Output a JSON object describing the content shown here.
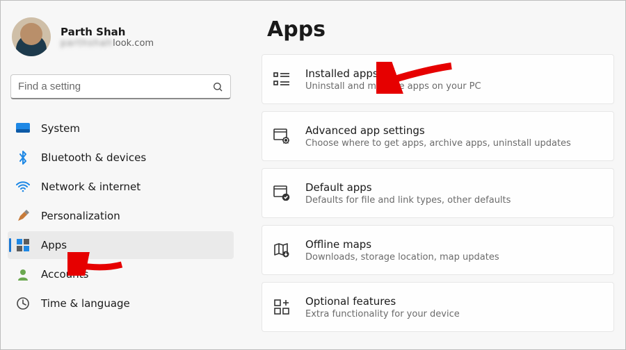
{
  "profile": {
    "name": "Parth Shah",
    "email_hidden_prefix": "parthshah",
    "email_visible_suffix": "look.com"
  },
  "search": {
    "placeholder": "Find a setting"
  },
  "sidebar": {
    "items": [
      {
        "label": "System"
      },
      {
        "label": "Bluetooth & devices"
      },
      {
        "label": "Network & internet"
      },
      {
        "label": "Personalization"
      },
      {
        "label": "Apps"
      },
      {
        "label": "Accounts"
      },
      {
        "label": "Time & language"
      }
    ],
    "selected_index": 4
  },
  "page": {
    "title": "Apps"
  },
  "cards": [
    {
      "title": "Installed apps",
      "subtitle": "Uninstall and manage apps on your PC"
    },
    {
      "title": "Advanced app settings",
      "subtitle": "Choose where to get apps, archive apps, uninstall updates"
    },
    {
      "title": "Default apps",
      "subtitle": "Defaults for file and link types, other defaults"
    },
    {
      "title": "Offline maps",
      "subtitle": "Downloads, storage location, map updates"
    },
    {
      "title": "Optional features",
      "subtitle": "Extra functionality for your device"
    }
  ]
}
